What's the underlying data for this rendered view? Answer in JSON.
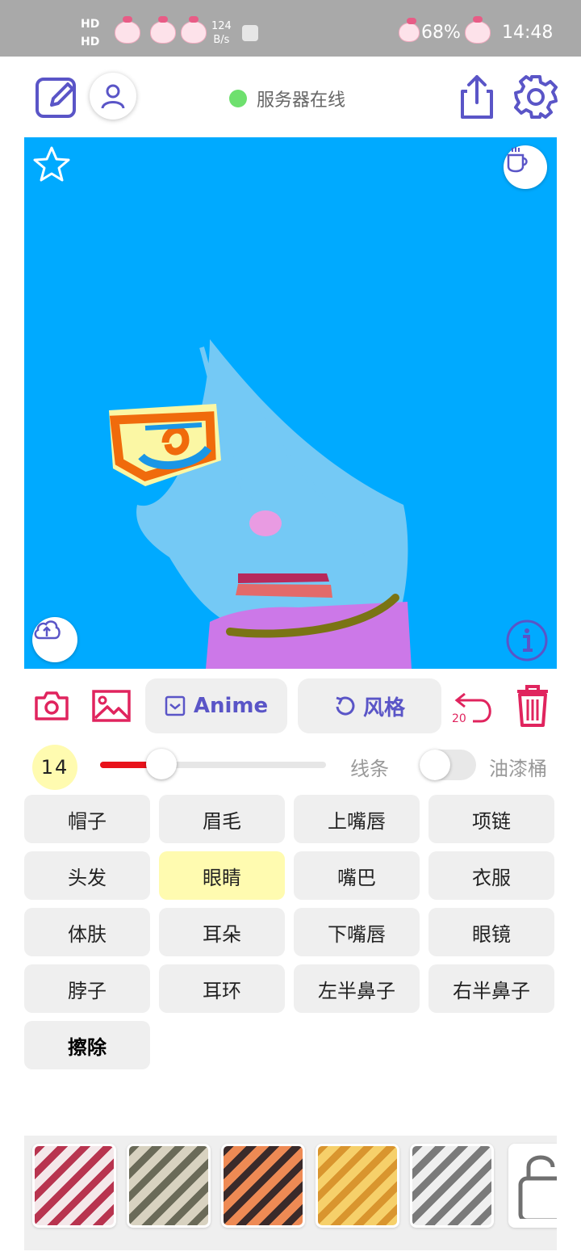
{
  "status_bar": {
    "hd_top": "HD",
    "hd_bottom": "HD",
    "net_speed_value": "124",
    "net_speed_unit": "B/s",
    "battery": "68%",
    "time": "14:48"
  },
  "header": {
    "edit_icon": "edit-square-icon",
    "profile_icon": "person-icon",
    "server_status": "服务器在线",
    "server_status_color": "#6ee06e",
    "share_icon": "share-upload-icon",
    "settings_icon": "gear-icon"
  },
  "canvas": {
    "background": "#00aaff",
    "favorite_icon": "star-icon",
    "coffee_icon": "coffee-cup-icon",
    "upload_icon": "cloud-upload-icon",
    "info_icon": "info-icon"
  },
  "toolbar": {
    "camera_icon": "camera-icon",
    "gallery_icon": "image-icon",
    "anime_label": "Anime",
    "style_label": "风格",
    "undo_count": "20",
    "undo_icon": "undo-icon",
    "delete_icon": "trash-icon",
    "accent": "#e0245e",
    "primary": "#5a55c7"
  },
  "brush": {
    "size": "14",
    "slider_fraction": 0.27,
    "line_mode_label": "线条",
    "bucket_mode_label": "油漆桶",
    "bucket_enabled": false
  },
  "parts": [
    {
      "label": "帽子",
      "selected": false
    },
    {
      "label": "眉毛",
      "selected": false
    },
    {
      "label": "上嘴唇",
      "selected": false
    },
    {
      "label": "项链",
      "selected": false
    },
    {
      "label": "头发",
      "selected": false
    },
    {
      "label": "眼睛",
      "selected": true
    },
    {
      "label": "嘴巴",
      "selected": false
    },
    {
      "label": "衣服",
      "selected": false
    },
    {
      "label": "体肤",
      "selected": false
    },
    {
      "label": "耳朵",
      "selected": false
    },
    {
      "label": "下嘴唇",
      "selected": false
    },
    {
      "label": "眼镜",
      "selected": false
    },
    {
      "label": "脖子",
      "selected": false
    },
    {
      "label": "耳环",
      "selected": false
    },
    {
      "label": "左半鼻子",
      "selected": false
    },
    {
      "label": "右半鼻子",
      "selected": false
    },
    {
      "label": "擦除",
      "selected": false
    }
  ],
  "styles": [
    {
      "name": "style-thumb-1",
      "color1": "#b8344f",
      "color2": "#f4e8ea"
    },
    {
      "name": "style-thumb-2",
      "color1": "#6a6a58",
      "color2": "#d8d2c0"
    },
    {
      "name": "style-thumb-3",
      "color1": "#3a2a2a",
      "color2": "#ee8a54"
    },
    {
      "name": "style-thumb-4",
      "color1": "#d9952e",
      "color2": "#f6d06a"
    },
    {
      "name": "style-thumb-5",
      "color1": "#7a7a7a",
      "color2": "#efefef"
    }
  ],
  "locked_icon": "lock-icon"
}
